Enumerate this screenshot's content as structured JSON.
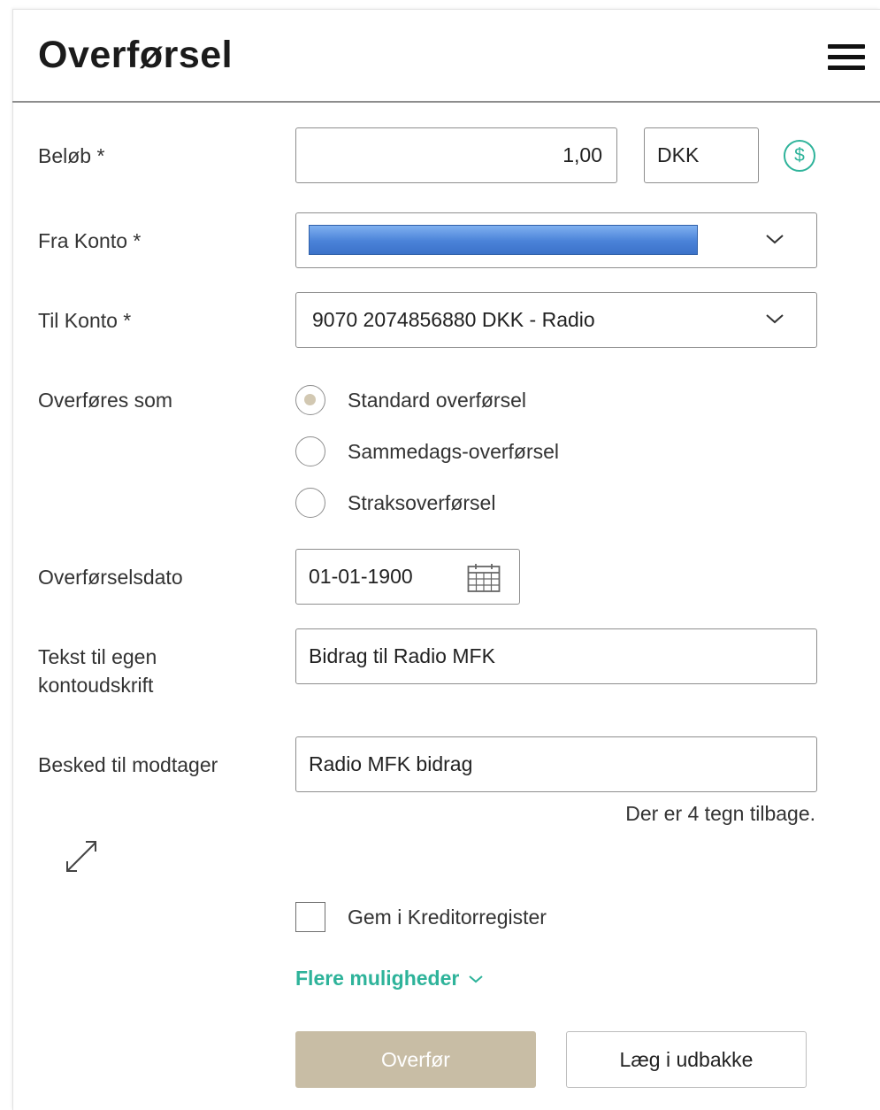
{
  "header": {
    "title": "Overførsel",
    "menu_icon": "hamburger-menu-icon"
  },
  "form": {
    "amount": {
      "label": "Beløb *",
      "value": "1,00",
      "currency": "DKK",
      "currency_icon": "dollar-circle-icon"
    },
    "from_account": {
      "label": "Fra Konto *",
      "value": ""
    },
    "to_account": {
      "label": "Til Konto *",
      "value": "9070 2074856880 DKK - Radio"
    },
    "transfer_type": {
      "label": "Overføres som",
      "options": [
        {
          "label": "Standard overførsel",
          "selected": true
        },
        {
          "label": "Sammedags-overførsel",
          "selected": false
        },
        {
          "label": "Straksoverførsel",
          "selected": false
        }
      ]
    },
    "date": {
      "label": "Overførselsdato",
      "value": "01-01-1900",
      "icon": "calendar-icon"
    },
    "own_text": {
      "label_line1": "Tekst til egen",
      "label_line2": "kontoudskrift",
      "value": "Bidrag til Radio MFK"
    },
    "message": {
      "label": "Besked til modtager",
      "value": "Radio MFK bidrag",
      "chars_left": "Der er 4 tegn tilbage."
    },
    "save_creditor": {
      "label": "Gem i Kreditorregister",
      "checked": false
    },
    "more_options": {
      "label": "Flere muligheder"
    }
  },
  "actions": {
    "submit": "Overfør",
    "outbox": "Læg i udbakke"
  },
  "colors": {
    "accent": "#2eb39a",
    "primary_button": "#c8bda5",
    "radio_fill": "#d2c8b2",
    "border": "#8e8e8e"
  }
}
